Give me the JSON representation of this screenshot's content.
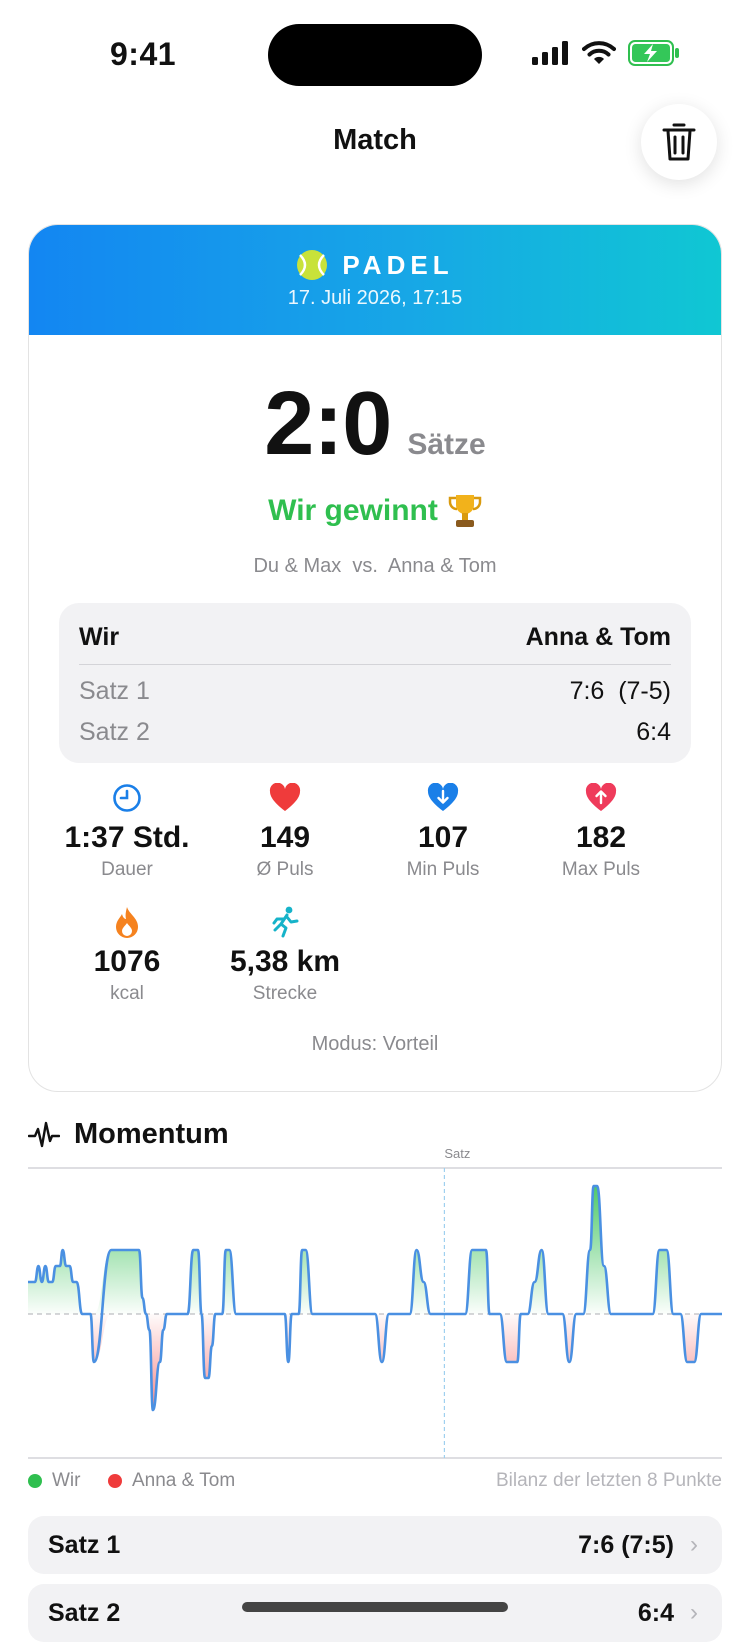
{
  "status": {
    "time": "9:41"
  },
  "header": {
    "title": "Match"
  },
  "card": {
    "sport": "PADEL",
    "date": "17. Juli 2026, 17:15",
    "score": "2:0",
    "score_unit": "Sätze",
    "result": "Wir gewinnt",
    "teams_line": "Du & Max  vs.  Anna & Tom",
    "sets_table": {
      "left_header": "Wir",
      "right_header": "Anna & Tom",
      "rows": [
        {
          "label": "Satz 1",
          "score": "7:6  (7-5)"
        },
        {
          "label": "Satz 2",
          "score": "6:4"
        }
      ]
    },
    "stats": [
      {
        "icon": "clock-icon",
        "value": "1:37 Std.",
        "label": "Dauer"
      },
      {
        "icon": "heart-icon",
        "value": "149",
        "label": "Ø Puls"
      },
      {
        "icon": "heart-down-icon",
        "value": "107",
        "label": "Min Puls"
      },
      {
        "icon": "heart-up-icon",
        "value": "182",
        "label": "Max Puls"
      },
      {
        "icon": "flame-icon",
        "value": "1076",
        "label": "kcal"
      },
      {
        "icon": "runner-icon",
        "value": "5,38 km",
        "label": "Strecke"
      }
    ],
    "mode": "Modus: Vorteil"
  },
  "momentum": {
    "title": "Momentum",
    "set_marker_label": "Satz",
    "legend": {
      "us": "Wir",
      "them": "Anna & Tom",
      "note": "Bilanz der letzten 8 Punkte"
    }
  },
  "set_list": [
    {
      "label": "Satz 1",
      "score": "7:6 (7:5)"
    },
    {
      "label": "Satz 2",
      "score": "6:4"
    }
  ],
  "colors": {
    "accent_blue": "#1386f2",
    "accent_teal": "#10c7d3",
    "win_green": "#2fbf4f",
    "loss_red": "#ef3b3b",
    "line_blue": "#4a90e2"
  },
  "chart_data": {
    "type": "line",
    "title": "Momentum",
    "xlabel": "",
    "ylabel": "",
    "ylim": [
      -8,
      8
    ],
    "grid": false,
    "legend_placement": "bottom-left",
    "vlines": [
      {
        "x": 0.6,
        "label": "Satz"
      }
    ],
    "series": [
      {
        "name": "Wir",
        "color": "#2fbf4f"
      },
      {
        "name": "Anna & Tom",
        "color": "#ef3b3b"
      }
    ],
    "x": [
      0,
      0.01,
      0.015,
      0.02,
      0.025,
      0.03,
      0.035,
      0.04,
      0.046,
      0.05,
      0.055,
      0.06,
      0.065,
      0.07,
      0.078,
      0.085,
      0.09,
      0.095,
      0.12,
      0.15,
      0.16,
      0.165,
      0.17,
      0.175,
      0.18,
      0.19,
      0.195,
      0.2,
      0.22,
      0.23,
      0.238,
      0.245,
      0.25,
      0.255,
      0.26,
      0.265,
      0.27,
      0.28,
      0.285,
      0.29,
      0.3,
      0.33,
      0.36,
      0.37,
      0.375,
      0.38,
      0.39,
      0.395,
      0.4,
      0.41,
      0.42,
      0.43,
      0.44,
      0.45,
      0.46,
      0.5,
      0.51,
      0.52,
      0.53,
      0.54,
      0.55,
      0.55,
      0.56,
      0.57,
      0.58,
      0.59,
      0.6,
      0.61,
      0.62,
      0.63,
      0.64,
      0.65,
      0.66,
      0.665,
      0.68,
      0.69,
      0.7,
      0.705,
      0.71,
      0.72,
      0.73,
      0.74,
      0.75,
      0.755,
      0.76,
      0.77,
      0.78,
      0.79,
      0.8,
      0.8,
      0.81,
      0.815,
      0.82,
      0.83,
      0.84,
      0.85,
      0.86,
      0.87,
      0.88,
      0.89,
      0.9,
      0.9,
      0.91,
      0.92,
      0.93,
      0.94,
      0.95,
      0.96,
      0.97,
      0.98,
      0.99,
      1
    ],
    "y": [
      2,
      2,
      3,
      2,
      3,
      2,
      2,
      3,
      3,
      4,
      3,
      3,
      2,
      2,
      0,
      0,
      0,
      -3,
      4,
      4,
      4,
      1,
      0,
      -1,
      -6,
      -3,
      -1,
      0,
      0,
      0,
      4,
      4,
      0,
      -4,
      -4,
      -2,
      0,
      0,
      4,
      4,
      0,
      0,
      0,
      0,
      -3,
      0,
      0,
      4,
      4,
      0,
      0,
      0,
      0,
      0,
      0,
      0,
      -3,
      0,
      0,
      0,
      0,
      0,
      4,
      2,
      0,
      0,
      0,
      0,
      0,
      0,
      4,
      4,
      4,
      0,
      0,
      -3,
      -3,
      -3,
      0,
      0,
      2,
      4,
      0,
      0,
      0,
      0,
      -3,
      0,
      0,
      0,
      4,
      8,
      8,
      3,
      0,
      0,
      0,
      0,
      0,
      0,
      0,
      0,
      4,
      4,
      0,
      0,
      -3,
      -3,
      0,
      0,
      0,
      0,
      0,
      -3
    ]
  }
}
